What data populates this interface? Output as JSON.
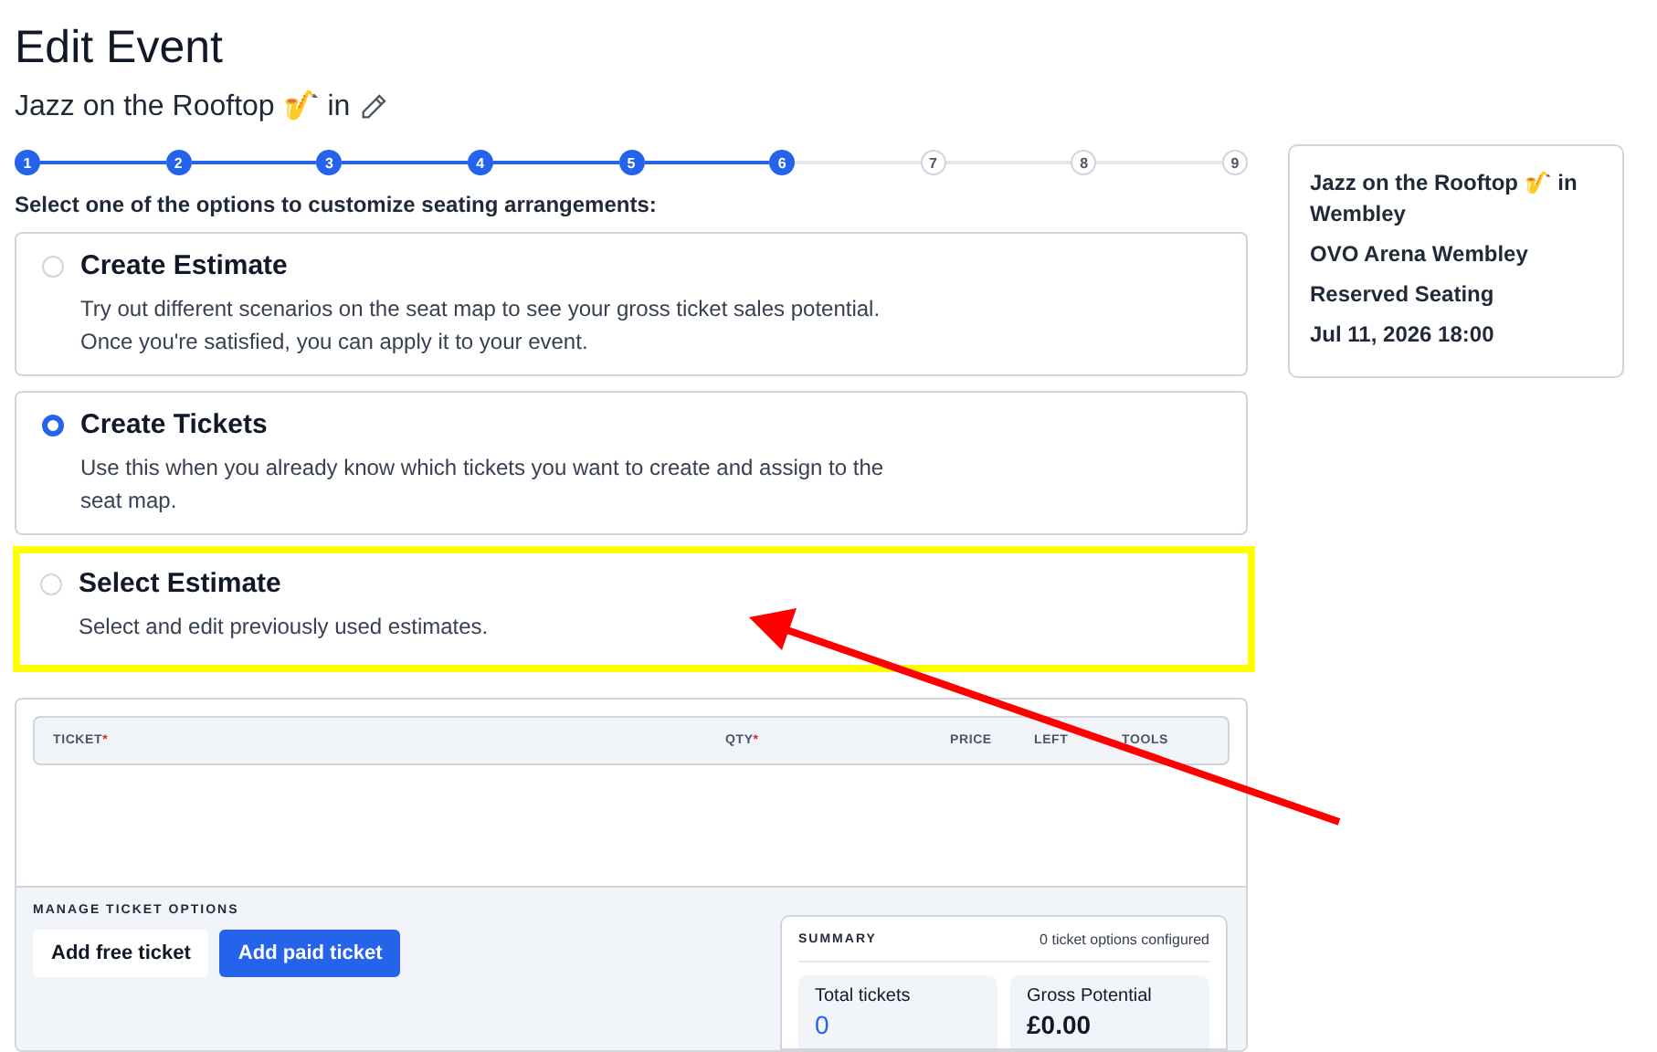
{
  "page": {
    "title": "Edit Event",
    "subtitle": "Jazz on the Rooftop 🎷 in"
  },
  "steps": [
    {
      "label": "1",
      "done": true
    },
    {
      "label": "2",
      "done": true
    },
    {
      "label": "3",
      "done": true
    },
    {
      "label": "4",
      "done": true
    },
    {
      "label": "5",
      "done": true
    },
    {
      "label": "6",
      "done": true
    },
    {
      "label": "7",
      "done": false
    },
    {
      "label": "8",
      "done": false
    },
    {
      "label": "9",
      "done": false
    }
  ],
  "instruction": "Select one of the options to customize seating arrangements:",
  "options": [
    {
      "title": "Create Estimate",
      "description": "Try out different scenarios on the seat map to see your gross ticket sales potential. Once you're satisfied, you can apply it to your event.",
      "selected": false,
      "highlighted": false
    },
    {
      "title": "Create Tickets",
      "description": "Use this when you already know which tickets you want to create and assign to the seat map.",
      "selected": true,
      "highlighted": false
    },
    {
      "title": "Select Estimate",
      "description": "Select and edit previously used estimates.",
      "selected": false,
      "highlighted": true
    }
  ],
  "table": {
    "columns": [
      {
        "label": "TICKET",
        "required": "*"
      },
      {
        "label": "QTY",
        "required": "*"
      },
      {
        "label": "PRICE"
      },
      {
        "label": "LEFT"
      },
      {
        "label": "TOOLS"
      }
    ]
  },
  "manage": {
    "heading": "MANAGE TICKET OPTIONS",
    "buttons": [
      {
        "label": "Add free ticket",
        "kind": "secondary"
      },
      {
        "label": "Add paid ticket",
        "kind": "primary"
      }
    ]
  },
  "summary": {
    "heading": "SUMMARY",
    "status": "0 ticket options configured",
    "stats": [
      {
        "label": "Total tickets",
        "value": "0",
        "kind": "count"
      },
      {
        "label": "Gross Potential",
        "value": "£0.00",
        "kind": "money"
      }
    ]
  },
  "event_card": {
    "lines": [
      "Jazz on the Rooftop 🎷 in Wembley",
      "OVO Arena Wembley",
      "Reserved Seating",
      "Jul 11, 2026 18:00"
    ]
  },
  "annotation": {
    "kind": "arrow"
  }
}
